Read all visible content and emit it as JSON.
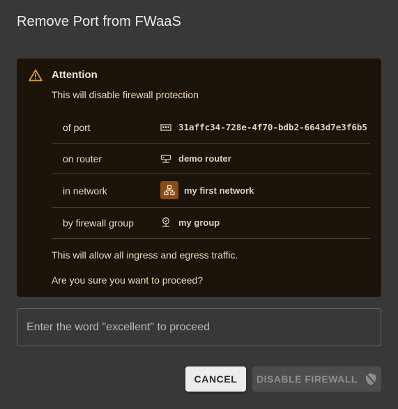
{
  "dialog": {
    "title": "Remove Port from FWaaS"
  },
  "warning": {
    "title": "Attention",
    "subtitle": "This will disable firewall protection",
    "rows": [
      {
        "label": "of port",
        "value": "31affc34-728e-4f70-bdb2-6643d7e3f6b5",
        "icon": "port-icon"
      },
      {
        "label": "on router",
        "value": "demo router",
        "icon": "router-icon"
      },
      {
        "label": "in network",
        "value": "my first network",
        "icon": "network-icon"
      },
      {
        "label": "by firewall group",
        "value": "my group",
        "icon": "firewall-group-icon"
      }
    ],
    "note1": "This will allow all ingress and egress traffic.",
    "note2": "Are you sure you want to proceed?"
  },
  "confirm": {
    "placeholder": "Enter the word \"excellent\" to proceed",
    "value": ""
  },
  "actions": {
    "cancel_label": "CANCEL",
    "disable_label": "DISABLE FIREWALL",
    "disable_icon": "shield-off-icon"
  },
  "colors": {
    "background": "#383838",
    "warning_bg": "#1b140a",
    "warning_accent": "#e8922e",
    "network_badge": "#8a4b16"
  }
}
